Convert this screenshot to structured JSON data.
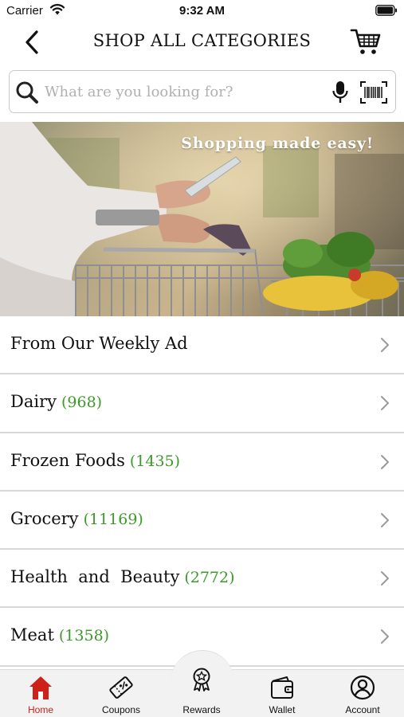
{
  "status_bar": {
    "carrier": "Carrier",
    "time": "9:32 AM"
  },
  "header": {
    "title": "SHOP ALL CATEGORIES",
    "back_icon": "chevron-left-icon",
    "cart_icon": "cart-icon"
  },
  "search": {
    "placeholder": "What are you looking for?",
    "value": ""
  },
  "banner": {
    "tagline": "Shopping made easy!"
  },
  "categories": [
    {
      "label": "From Our Weekly Ad",
      "count": ""
    },
    {
      "label": "Dairy",
      "count": "(968)"
    },
    {
      "label": "Frozen Foods",
      "count": "(1435)"
    },
    {
      "label": "Grocery",
      "count": "(11169)"
    },
    {
      "label": "Health  and  Beauty",
      "count": "(2772)"
    },
    {
      "label": "Meat",
      "count": "(1358)"
    }
  ],
  "tabs": [
    {
      "label": "Home",
      "icon": "home-icon",
      "active": true
    },
    {
      "label": "Coupons",
      "icon": "coupon-icon",
      "active": false
    },
    {
      "label": "Rewards",
      "icon": "rewards-icon",
      "active": false
    },
    {
      "label": "Wallet",
      "icon": "wallet-icon",
      "active": false
    },
    {
      "label": "Account",
      "icon": "account-icon",
      "active": false
    }
  ],
  "colors": {
    "accent": "#d0201a",
    "count_green": "#3c9a2a"
  }
}
